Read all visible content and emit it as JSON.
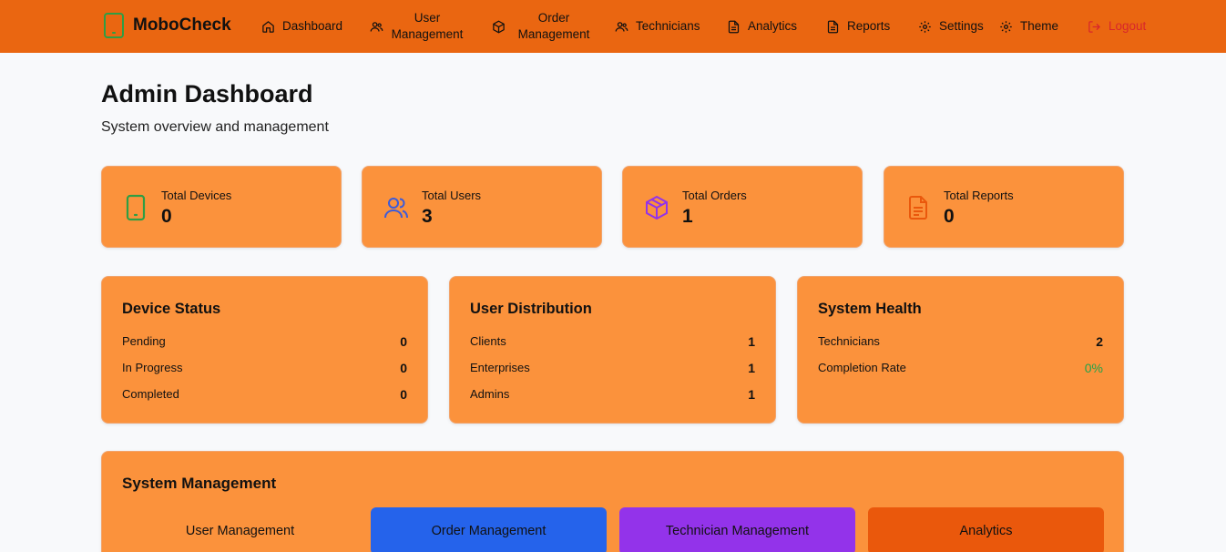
{
  "brand": {
    "name": "MoboCheck"
  },
  "nav": {
    "dashboard": "Dashboard",
    "user_management": "User Management",
    "order_management": "Order Management",
    "technicians": "Technicians",
    "analytics": "Analytics",
    "reports": "Reports",
    "settings": "Settings",
    "theme": "Theme",
    "logout": "Logout"
  },
  "header": {
    "title": "Admin Dashboard",
    "subtitle": "System overview and management"
  },
  "stats": [
    {
      "label": "Total Devices",
      "value": "0",
      "icon": "phone-icon",
      "color": "#2f9e44"
    },
    {
      "label": "Total Users",
      "value": "3",
      "icon": "users-icon",
      "color": "#3b5bdb"
    },
    {
      "label": "Total Orders",
      "value": "1",
      "icon": "package-icon",
      "color": "#9333ea"
    },
    {
      "label": "Total Reports",
      "value": "0",
      "icon": "file-text-icon",
      "color": "#ea580c"
    }
  ],
  "device_status": {
    "title": "Device Status",
    "rows": [
      {
        "label": "Pending",
        "value": "0"
      },
      {
        "label": "In Progress",
        "value": "0"
      },
      {
        "label": "Completed",
        "value": "0"
      }
    ]
  },
  "user_distribution": {
    "title": "User Distribution",
    "rows": [
      {
        "label": "Clients",
        "value": "1"
      },
      {
        "label": "Enterprises",
        "value": "1"
      },
      {
        "label": "Admins",
        "value": "1"
      }
    ]
  },
  "system_health": {
    "title": "System Health",
    "rows": [
      {
        "label": "Technicians",
        "value": "2"
      },
      {
        "label": "Completion Rate",
        "value": "0%"
      }
    ]
  },
  "system_management": {
    "title": "System Management",
    "buttons": {
      "user": "User Management",
      "order": "Order Management",
      "technician": "Technician Management",
      "analytics": "Analytics"
    }
  },
  "colors": {
    "nav_bg": "#ea6611",
    "card_bg": "#fb923c",
    "accent_blue": "#2563eb",
    "accent_purple": "#9333ea",
    "accent_orange": "#ea580c",
    "logout": "#d8262b",
    "success": "#22a34a"
  }
}
